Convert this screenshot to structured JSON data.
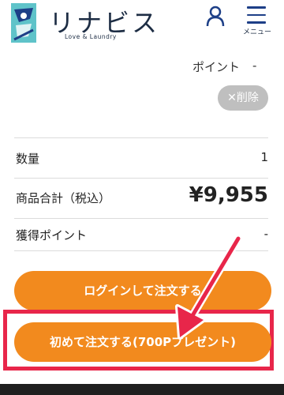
{
  "header": {
    "brand": "リナビス",
    "brand_sub": "Love & Laundry",
    "menu_label": "メニュー"
  },
  "point": {
    "label": "ポイント",
    "value": "-"
  },
  "delete_button": "✕削除",
  "summary": {
    "quantity_label": "数量",
    "quantity_value": "1",
    "total_label": "商品合計（税込）",
    "total_value": "¥9,955",
    "earn_label": "獲得ポイント",
    "earn_value": "-"
  },
  "buttons": {
    "login": "ログインして注文する",
    "first_order": "初めて注文する(700Pプレゼント)"
  },
  "colors": {
    "accent": "#f28a1e",
    "highlight": "#e8264a",
    "brand": "#1d3f87"
  }
}
